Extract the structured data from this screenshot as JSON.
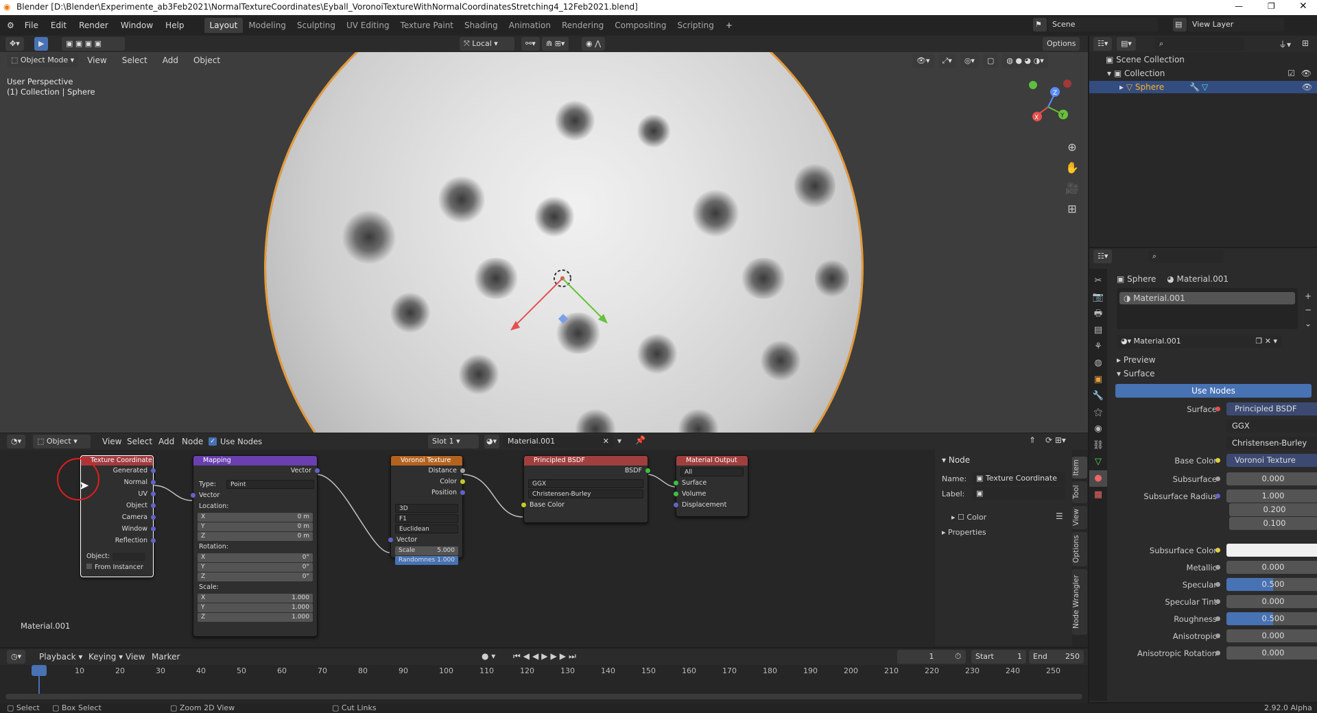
{
  "title": "Blender [D:\\Blender\\Experimente_ab3Feb2021\\NormalTextureCoordinates\\Eyball_VoronoiTextureWithNormalCoordinatesStretching4_12Feb2021.blend]",
  "menu": [
    "File",
    "Edit",
    "Render",
    "Window",
    "Help"
  ],
  "workspaces": [
    "Layout",
    "Modeling",
    "Sculpting",
    "UV Editing",
    "Texture Paint",
    "Shading",
    "Animation",
    "Rendering",
    "Compositing",
    "Scripting"
  ],
  "scene": "Scene",
  "view_layer": "View Layer",
  "viewport": {
    "mode": "Object Mode",
    "menus": [
      "View",
      "Select",
      "Add",
      "Object"
    ],
    "orientation": "Local",
    "options": "Options",
    "persp": "User Perspective",
    "coll": "(1) Collection | Sphere"
  },
  "outliner": {
    "scene_collection": "Scene Collection",
    "collection": "Collection",
    "sphere": "Sphere"
  },
  "node_header": {
    "editor": "Object",
    "menus": [
      "View",
      "Select",
      "Add",
      "Node"
    ],
    "use_nodes": "Use Nodes",
    "slot": "Slot 1",
    "material": "Material.001"
  },
  "nodes": {
    "texcoord": {
      "title": "Texture Coordinate",
      "outs": [
        "Generated",
        "Normal",
        "UV",
        "Object",
        "Camera",
        "Window",
        "Reflection"
      ],
      "object": "Object:",
      "from_inst": "From Instancer"
    },
    "mapping": {
      "title": "Mapping",
      "out": "Vector",
      "type_label": "Type:",
      "type": "Point",
      "vector": "Vector",
      "location": "Location:",
      "rotation": "Rotation:",
      "scale": "Scale:",
      "loc": [
        [
          "X",
          "0 m"
        ],
        [
          "Y",
          "0 m"
        ],
        [
          "Z",
          "0 m"
        ]
      ],
      "rot": [
        [
          "X",
          "0°"
        ],
        [
          "Y",
          "0°"
        ],
        [
          "Z",
          "0°"
        ]
      ],
      "scl": [
        [
          "X",
          "1.000"
        ],
        [
          "Y",
          "1.000"
        ],
        [
          "Z",
          "1.000"
        ]
      ]
    },
    "voronoi": {
      "title": "Voronoi Texture",
      "outs": [
        "Distance",
        "Color",
        "Position"
      ],
      "dims": "3D",
      "feature": "F1",
      "metric": "Euclidean",
      "vector": "Vector",
      "scale_l": "Scale",
      "scale_v": "5.000",
      "rand_l": "Randomnes",
      "rand_v": "1.000"
    },
    "bsdf": {
      "title": "Principled BSDF",
      "out": "BSDF",
      "dist": "GGX",
      "sss": "Christensen-Burley",
      "base": "Base Color"
    },
    "output": {
      "title": "Material Output",
      "target": "All",
      "ins": [
        "Surface",
        "Volume",
        "Displacement"
      ]
    }
  },
  "node_label": "Material.001",
  "npanel": {
    "header": "Node",
    "name_l": "Name:",
    "name_v": "Texture Coordinate",
    "label_l": "Label:",
    "color": "Color",
    "properties": "Properties",
    "tabs": [
      "Item",
      "Tool",
      "View",
      "Options",
      "Node Wrangler"
    ]
  },
  "timeline": {
    "menus": [
      "Playback",
      "Keying",
      "View",
      "Marker"
    ],
    "frame": "1",
    "start_l": "Start",
    "start_v": "1",
    "end_l": "End",
    "end_v": "250",
    "ticks": [
      "1",
      "10",
      "20",
      "30",
      "40",
      "50",
      "60",
      "70",
      "80",
      "90",
      "100",
      "110",
      "120",
      "130",
      "140",
      "150",
      "160",
      "170",
      "180",
      "190",
      "200",
      "210",
      "220",
      "230",
      "240",
      "250"
    ]
  },
  "status": {
    "select": "Select",
    "box": "Box Select",
    "zoom": "Zoom 2D View",
    "cut": "Cut Links",
    "version": "2.92.0 Alpha"
  },
  "props": {
    "object": "Sphere",
    "material": "Material.001",
    "slot_item": "Material.001",
    "mat_field": "Material.001",
    "preview": "Preview",
    "surface": "Surface",
    "use_nodes": "Use Nodes",
    "rows": [
      {
        "label": "Surface",
        "value": "Principled BSDF",
        "kind": "link",
        "dot": "#e05050"
      },
      {
        "label": "",
        "value": "GGX",
        "kind": "dd"
      },
      {
        "label": "",
        "value": "Christensen-Burley",
        "kind": "dd"
      },
      {
        "label": "Base Color",
        "value": "Voronoi Texture",
        "kind": "link",
        "dot": "#e0d040"
      },
      {
        "label": "Subsurface",
        "value": "0.000",
        "kind": "num",
        "dot": "#a0a0a0"
      },
      {
        "label": "Subsurface Radius",
        "value": "1.000",
        "kind": "num",
        "dot": "#6363c7"
      },
      {
        "label": "",
        "value": "0.200",
        "kind": "num"
      },
      {
        "label": "",
        "value": "0.100",
        "kind": "num"
      },
      {
        "label": "Subsurface Color",
        "value": "",
        "kind": "color",
        "dot": "#e0d040"
      },
      {
        "label": "Metallic",
        "value": "0.000",
        "kind": "num",
        "dot": "#a0a0a0"
      },
      {
        "label": "Specular",
        "value": "0.500",
        "kind": "blue",
        "dot": "#a0a0a0"
      },
      {
        "label": "Specular Tint",
        "value": "0.000",
        "kind": "num",
        "dot": "#a0a0a0"
      },
      {
        "label": "Roughness",
        "value": "0.500",
        "kind": "blue",
        "dot": "#a0a0a0"
      },
      {
        "label": "Anisotropic",
        "value": "0.000",
        "kind": "num",
        "dot": "#a0a0a0"
      },
      {
        "label": "Anisotropic Rotation",
        "value": "0.000",
        "kind": "num",
        "dot": "#a0a0a0"
      }
    ]
  }
}
